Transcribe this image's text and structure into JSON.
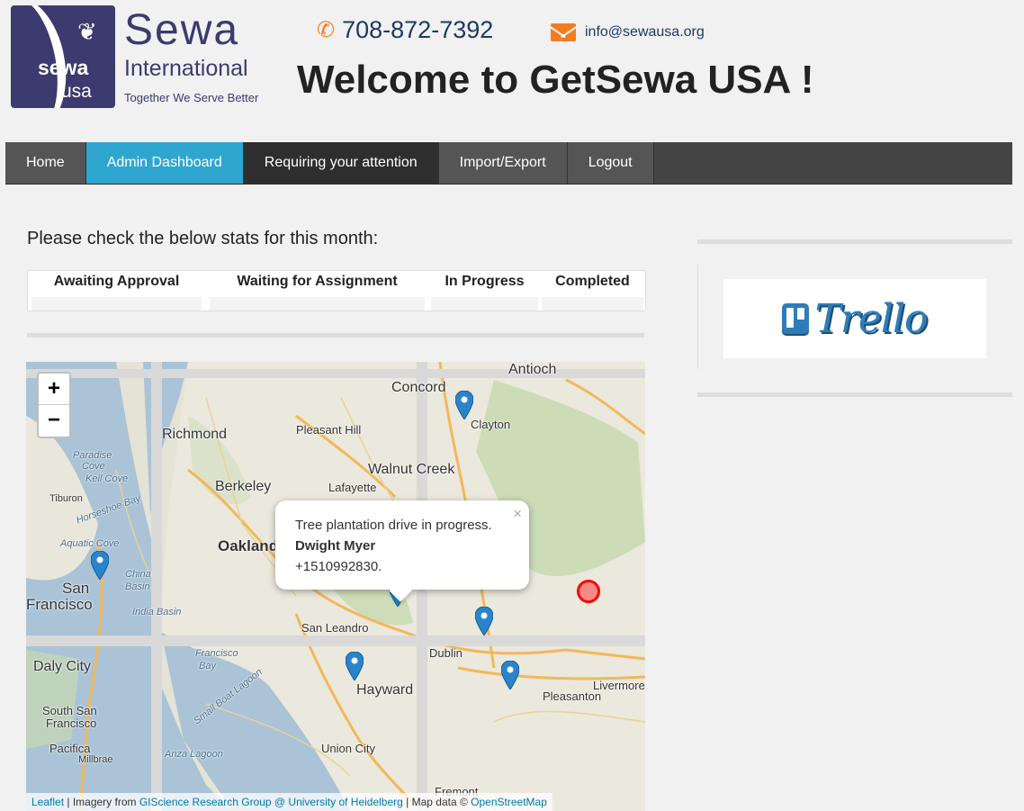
{
  "header": {
    "logo": {
      "word1": "sewa",
      "word2": "usa",
      "title": "Sewa",
      "subtitle": "International",
      "tagline": "Together We Serve Better"
    },
    "phone": "708-872-7392",
    "email": "info@sewausa.org",
    "welcome": "Welcome to GetSewa USA !"
  },
  "nav": {
    "items": [
      {
        "label": "Home"
      },
      {
        "label": "Admin Dashboard"
      },
      {
        "label": "Requiring your attention"
      },
      {
        "label": "Import/Export"
      },
      {
        "label": "Logout"
      }
    ]
  },
  "stats": {
    "heading": "Please check the below stats for this month:",
    "columns": [
      "Awaiting Approval",
      "Waiting for Assignment",
      "In Progress",
      "Completed"
    ]
  },
  "sidebar": {
    "trello_text": "Trello"
  },
  "map": {
    "zoom_in": "+",
    "zoom_out": "−",
    "labels": {
      "richmond": "Richmond",
      "concord": "Concord",
      "antioch": "Antioch",
      "clayton": "Clayton",
      "pleasant_hill": "Pleasant Hill",
      "walnut_creek": "Walnut Creek",
      "lafayette": "Lafayette",
      "berkeley": "Berkeley",
      "oakland": "Oakland",
      "san_francisco_1": "San",
      "san_francisco_2": "Francisco",
      "san_leandro": "San Leandro",
      "daly_city": "Daly City",
      "south_sf_1": "South San",
      "south_sf_2": "Francisco",
      "hayward": "Hayward",
      "union_city": "Union City",
      "dublin": "Dublin",
      "pleasanton": "Pleasanton",
      "livermore": "Livermore",
      "fremont": "Fremont",
      "pacifica": "Pacifica",
      "millbrae": "Millbrae",
      "tiburon": "Tiburon",
      "paradise_cove_1": "Paradise",
      "paradise_cove_2": "Cove",
      "keil_cove": "Keil Cove",
      "horseshoe_bay": "Horseshoe Bay",
      "aquatic_cove": "Aquatic Cove",
      "china_basin_1": "China",
      "china_basin_2": "Basin",
      "india_basin": "India Basin",
      "sf_bay_1": "Francisco",
      "sf_bay_2": "Bay",
      "small_boat_lagoon": "Small Boat Lagoon",
      "anza_lagoon": "Anza Lagoon"
    },
    "popup": {
      "close": "×",
      "line1": "Tree plantation drive in progress.",
      "name": "Dwight Myer",
      "phone": "+1510992830."
    },
    "attribution": {
      "leaflet": "Leaflet",
      "imagery_prefix": " | Imagery from ",
      "imagery_link": "GIScience Research Group @ University of Heidelberg",
      "data_prefix": " | Map data © ",
      "data_link": "OpenStreetMap"
    }
  }
}
